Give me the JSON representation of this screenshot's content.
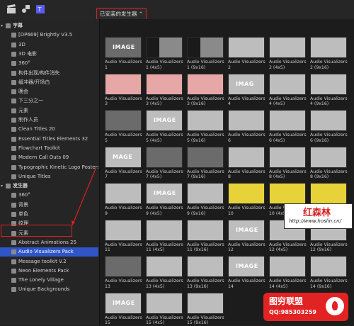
{
  "toolbar": {
    "selector_label": "已安装的发生器 ⌃"
  },
  "search": {
    "placeholder": ""
  },
  "sidebar": {
    "items": [
      {
        "label": "字幕",
        "level": 0,
        "tri": "▾",
        "bold": true
      },
      {
        "label": "[DP669] Brightly V3.5",
        "level": 1
      },
      {
        "label": "3D",
        "level": 1
      },
      {
        "label": "3D 电影",
        "level": 1
      },
      {
        "label": "360°",
        "level": 1
      },
      {
        "label": "构件出现/构件消失",
        "level": 1
      },
      {
        "label": "缓冲器/开场白",
        "level": 1
      },
      {
        "label": "晚会",
        "level": 1
      },
      {
        "label": "下三分之一",
        "level": 1
      },
      {
        "label": "元素",
        "level": 1
      },
      {
        "label": "制作人员",
        "level": 1
      },
      {
        "label": "Clean Titles 20",
        "level": 1
      },
      {
        "label": "Essential Titles Elements 32",
        "level": 1
      },
      {
        "label": "Flowchart Toolkit",
        "level": 1
      },
      {
        "label": "Modern Call Outs 09",
        "level": 1
      },
      {
        "label": "Typographic Kinetic Logo Posters",
        "level": 1
      },
      {
        "label": "Unique Titles",
        "level": 1
      },
      {
        "label": "发生器",
        "level": 0,
        "tri": "▾",
        "bold": true
      },
      {
        "label": "360°",
        "level": 1
      },
      {
        "label": "背景",
        "level": 1
      },
      {
        "label": "单色",
        "level": 1
      },
      {
        "label": "纹理",
        "level": 1
      },
      {
        "label": "元素",
        "level": 1
      },
      {
        "label": "Abstract Animations 25",
        "level": 1
      },
      {
        "label": "Audio Visualizers Pack",
        "level": 1,
        "selected": true
      },
      {
        "label": "Message toolkit V.2",
        "level": 1
      },
      {
        "label": "Neon Elements Pack",
        "level": 1
      },
      {
        "label": "The Lonely Village",
        "level": 1
      },
      {
        "label": "Unique Backgrounds",
        "level": 1
      }
    ]
  },
  "grid": {
    "tiles": [
      {
        "l1": "Audio Visualizers",
        "l2": "1",
        "style": "dark",
        "mark": "IMAGE"
      },
      {
        "l1": "Audio Visualizers",
        "l2": "1 (4x5)",
        "style": "narrow",
        "mark": ""
      },
      {
        "l1": "Audio Visualizers",
        "l2": "1 (9x16)",
        "style": "narrow",
        "mark": ""
      },
      {
        "l1": "Audio Visualizers",
        "l2": "2",
        "style": "light",
        "mark": ""
      },
      {
        "l1": "Audio Visualizers",
        "l2": "2 (4x5)",
        "style": "light",
        "mark": ""
      },
      {
        "l1": "Audio Visualizers",
        "l2": "2 (9x16)",
        "style": "light",
        "mark": ""
      },
      {
        "l1": "Audio Visualizers",
        "l2": "3",
        "style": "pink",
        "mark": ""
      },
      {
        "l1": "Audio Visualizers",
        "l2": "3 (4x5)",
        "style": "pink",
        "mark": ""
      },
      {
        "l1": "Audio Visualizers",
        "l2": "3 (9x16)",
        "style": "pink",
        "mark": ""
      },
      {
        "l1": "Audio Visualizers",
        "l2": "4",
        "style": "light",
        "mark": "IMAG"
      },
      {
        "l1": "Audio Visualizers",
        "l2": "4 (4x5)",
        "style": "light",
        "mark": ""
      },
      {
        "l1": "Audio Visualizers",
        "l2": "4 (9x16)",
        "style": "light",
        "mark": ""
      },
      {
        "l1": "Audio Visualizers",
        "l2": "5",
        "style": "dark",
        "mark": ""
      },
      {
        "l1": "Audio Visualizers",
        "l2": "5 (4x5)",
        "style": "light",
        "mark": "IMAGE"
      },
      {
        "l1": "Audio Visualizers",
        "l2": "5 (9x16)",
        "style": "light",
        "mark": ""
      },
      {
        "l1": "Audio Visualizers",
        "l2": "6",
        "style": "light",
        "mark": ""
      },
      {
        "l1": "Audio Visualizers",
        "l2": "6 (4x5)",
        "style": "light",
        "mark": ""
      },
      {
        "l1": "Audio Visualizers",
        "l2": "6 (9x16)",
        "style": "light",
        "mark": ""
      },
      {
        "l1": "Audio Visualizers",
        "l2": "7",
        "style": "light",
        "mark": "MAGE"
      },
      {
        "l1": "Audio Visualizers",
        "l2": "7 (4x5)",
        "style": "dark",
        "mark": ""
      },
      {
        "l1": "Audio Visualizers",
        "l2": "7 (9x16)",
        "style": "dark",
        "mark": ""
      },
      {
        "l1": "Audio Visualizers",
        "l2": "8",
        "style": "light",
        "mark": ""
      },
      {
        "l1": "Audio Visualizers",
        "l2": "8 (4x5)",
        "style": "light",
        "mark": ""
      },
      {
        "l1": "Audio Visualizers",
        "l2": "8 (9x16)",
        "style": "light",
        "mark": ""
      },
      {
        "l1": "Audio Visualizers",
        "l2": "9",
        "style": "light",
        "mark": ""
      },
      {
        "l1": "Audio Visualizers",
        "l2": "9 (4x5)",
        "style": "light",
        "mark": "IMAGE"
      },
      {
        "l1": "Audio Visualizers",
        "l2": "9 (9x16)",
        "style": "light",
        "mark": ""
      },
      {
        "l1": "Audio Visualizers",
        "l2": "10",
        "style": "yellow",
        "mark": ""
      },
      {
        "l1": "Audio Visualizers",
        "l2": "10 (4x5)",
        "style": "yellow",
        "mark": ""
      },
      {
        "l1": "Audio Visualizers",
        "l2": "10 (9x16)",
        "style": "yellow",
        "mark": ""
      },
      {
        "l1": "Audio Visualizers",
        "l2": "11",
        "style": "light",
        "mark": ""
      },
      {
        "l1": "Audio Visualizers",
        "l2": "11 (4x5)",
        "style": "light",
        "mark": ""
      },
      {
        "l1": "Audio Visualizers",
        "l2": "11 (9x16)",
        "style": "light",
        "mark": ""
      },
      {
        "l1": "Audio Visualizers",
        "l2": "12",
        "style": "light",
        "mark": "IMAGE"
      },
      {
        "l1": "Audio Visualizers",
        "l2": "12 (4x5)",
        "style": "light",
        "mark": ""
      },
      {
        "l1": "Audio Visualizers",
        "l2": "12 (9x16)",
        "style": "light",
        "mark": ""
      },
      {
        "l1": "Audio Visualizers",
        "l2": "13",
        "style": "dark",
        "mark": ""
      },
      {
        "l1": "Audio Visualizers",
        "l2": "13 (4x5)",
        "style": "light",
        "mark": ""
      },
      {
        "l1": "Audio Visualizers",
        "l2": "13 (9x16)",
        "style": "light",
        "mark": ""
      },
      {
        "l1": "Audio Visualizers",
        "l2": "14",
        "style": "light",
        "mark": "IMAGE"
      },
      {
        "l1": "Audio Visualizers",
        "l2": "14 (4x5)",
        "style": "light",
        "mark": ""
      },
      {
        "l1": "Audio Visualizers",
        "l2": "14 (9x16)",
        "style": "light",
        "mark": ""
      },
      {
        "l1": "Audio Visualizers",
        "l2": "15",
        "style": "light",
        "mark": "IMAGE"
      },
      {
        "l1": "Audio Visualizers",
        "l2": "15 (4x5)",
        "style": "light",
        "mark": ""
      },
      {
        "l1": "Audio Visualizers",
        "l2": "15 (9x16)",
        "style": "light",
        "mark": ""
      }
    ]
  },
  "watermarks": {
    "site_name": "红森林",
    "site_url": "http://www.hoslin.cn/",
    "union_name": "图穷联盟",
    "union_qq": "QQ:985303259"
  }
}
